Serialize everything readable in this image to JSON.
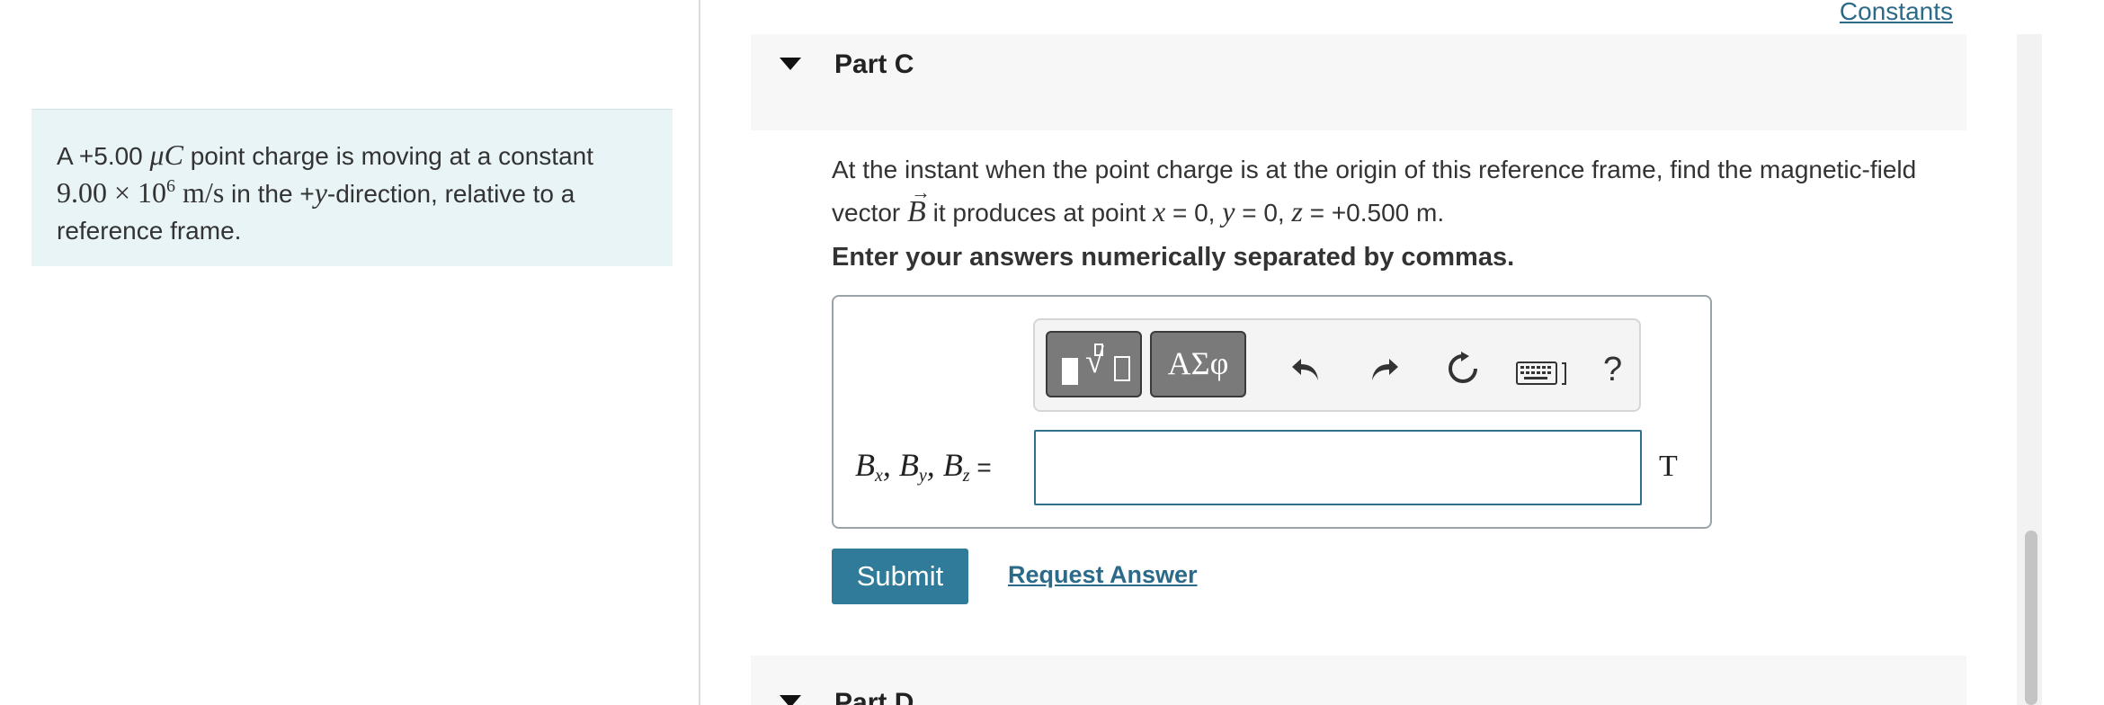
{
  "problem": {
    "prefix": "A +5.00 ",
    "charge_unit": "μC",
    "text_1": " point charge is moving at a constant",
    "speed_mantissa": "9.00 × 10",
    "speed_exp": "6",
    "speed_unit": " m/s",
    "text_2": " in the +",
    "direction_var": "y",
    "text_3": "-direction, relative to a reference frame."
  },
  "constants_link": "Constants",
  "part_c": {
    "title": "Part C",
    "question_1": "At the instant when the point charge is at the origin of this reference frame, find the magnetic-field vector ",
    "vector_symbol": "B",
    "question_2": " it produces at point ",
    "pt_x_var": "x",
    "pt_x_val": " = 0, ",
    "pt_y_var": "y",
    "pt_y_val": " = 0, ",
    "pt_z_var": "z",
    "pt_z_val": " = +0.500 m.",
    "instruction": "Enter your answers numerically separated by commas.",
    "answer": {
      "label_B": "B",
      "sub_x": "x",
      "sep_1": ", ",
      "sub_y": "y",
      "sep_2": ", ",
      "sub_z": "z",
      "equals": " =",
      "value": "",
      "unit": "T"
    },
    "toolbar": {
      "greek_label": "ΑΣφ",
      "help_label": "?"
    },
    "submit_label": "Submit",
    "request_answer_label": "Request Answer"
  },
  "part_d": {
    "title": "Part D"
  }
}
